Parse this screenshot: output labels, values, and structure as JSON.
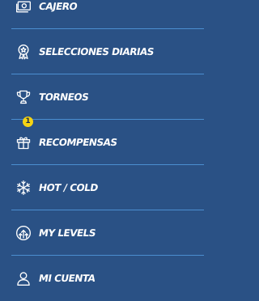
{
  "menu": {
    "items": [
      {
        "label": "CAJERO",
        "icon": "cashier-icon"
      },
      {
        "label": "SELECCIONES DIARIAS",
        "icon": "medal-icon"
      },
      {
        "label": "TORNEOS",
        "icon": "trophy-icon"
      },
      {
        "label": "RECOMPENSAS",
        "icon": "gift-icon",
        "badge": "1"
      },
      {
        "label": "HOT / COLD",
        "icon": "snowflake-icon"
      },
      {
        "label": "MY LEVELS",
        "icon": "level-up-icon"
      },
      {
        "label": "MI CUENTA",
        "icon": "user-icon"
      }
    ]
  },
  "colors": {
    "background": "#2a5185",
    "divider": "#4b8ed0",
    "text": "#ffffff",
    "badge": "#f5d312"
  }
}
